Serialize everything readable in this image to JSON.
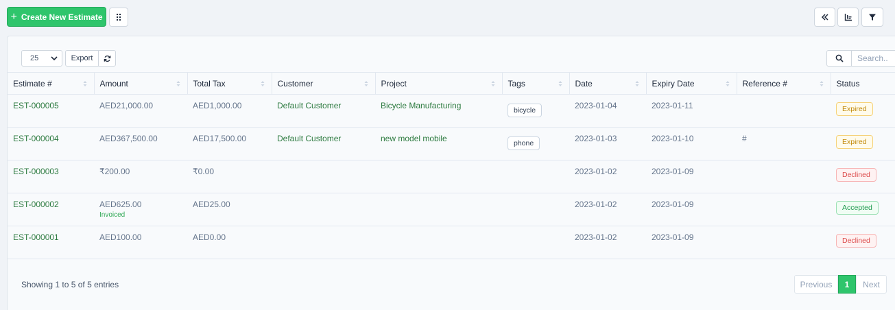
{
  "toolbar": {
    "create_label": "Create New Estimate"
  },
  "table_controls": {
    "page_length": "25",
    "export_label": "Export",
    "search_placeholder": "Search.."
  },
  "columns": [
    "Estimate #",
    "Amount",
    "Total Tax",
    "Customer",
    "Project",
    "Tags",
    "Date",
    "Expiry Date",
    "Reference #",
    "Status"
  ],
  "rows": [
    {
      "estimate": "EST-000005",
      "amount": "AED21,000.00",
      "amount_note": "",
      "tax": "AED1,000.00",
      "customer": "Default Customer",
      "project": "Bicycle Manufacturing",
      "tag": "bicycle",
      "date": "2023-01-04",
      "expiry": "2023-01-11",
      "reference": "",
      "status": "Expired"
    },
    {
      "estimate": "EST-000004",
      "amount": "AED367,500.00",
      "amount_note": "",
      "tax": "AED17,500.00",
      "customer": "Default Customer",
      "project": "new model mobile",
      "tag": "phone",
      "date": "2023-01-03",
      "expiry": "2023-01-10",
      "reference": "#",
      "status": "Expired"
    },
    {
      "estimate": "EST-000003",
      "amount": "₹200.00",
      "amount_note": "",
      "tax": "₹0.00",
      "customer": "",
      "project": "",
      "tag": "",
      "date": "2023-01-02",
      "expiry": "2023-01-09",
      "reference": "",
      "status": "Declined"
    },
    {
      "estimate": "EST-000002",
      "amount": "AED625.00",
      "amount_note": "Invoiced",
      "tax": "AED25.00",
      "customer": "",
      "project": "",
      "tag": "",
      "date": "2023-01-02",
      "expiry": "2023-01-09",
      "reference": "",
      "status": "Accepted"
    },
    {
      "estimate": "EST-000001",
      "amount": "AED100.00",
      "amount_note": "",
      "tax": "AED0.00",
      "customer": "",
      "project": "",
      "tag": "",
      "date": "2023-01-02",
      "expiry": "2023-01-09",
      "reference": "",
      "status": "Declined"
    }
  ],
  "footer": {
    "info": "Showing 1 to 5 of 5 entries",
    "previous": "Previous",
    "current_page": "1",
    "next": "Next"
  },
  "colors": {
    "accent": "#2fc56c",
    "link": "#2c7a3f",
    "expired": "#c28a0a",
    "declined": "#dc4a4a",
    "accepted": "#1f9a4e"
  },
  "icons": {
    "create": "plus-icon",
    "layout": "grip-icon",
    "collapse": "double-chevron-left-icon",
    "stats": "bar-chart-icon",
    "filter": "filter-icon",
    "reload": "refresh-icon",
    "search": "search-icon"
  }
}
